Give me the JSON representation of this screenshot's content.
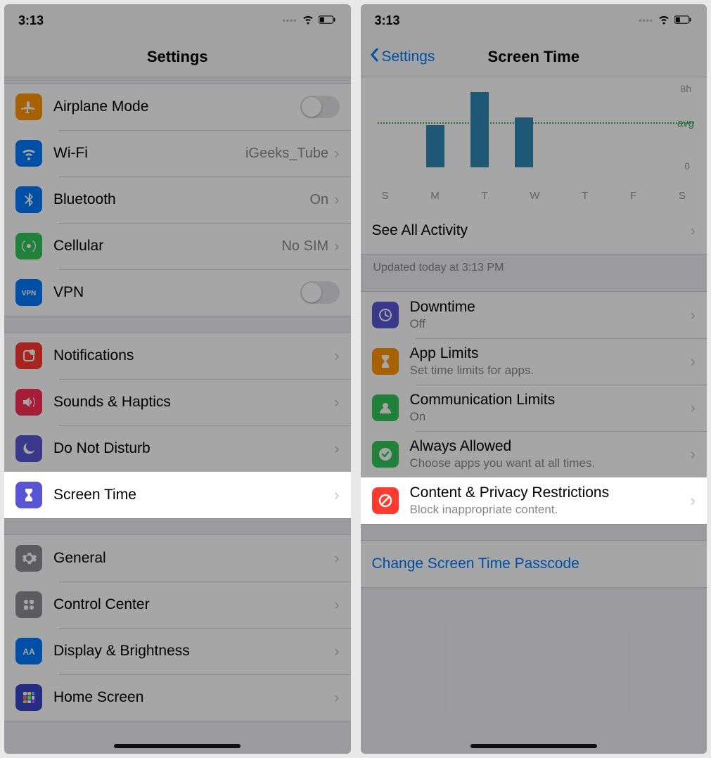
{
  "statusbar": {
    "time": "3:13"
  },
  "left": {
    "title": "Settings",
    "groups": [
      [
        {
          "name": "airplane-mode",
          "icon": "airplane",
          "ibg": "#ff9500",
          "label": "Airplane Mode",
          "type": "toggle"
        },
        {
          "name": "wifi",
          "icon": "wifi",
          "ibg": "#007aff",
          "label": "Wi-Fi",
          "value": "iGeeks_Tube"
        },
        {
          "name": "bluetooth",
          "icon": "bluetooth",
          "ibg": "#007aff",
          "label": "Bluetooth",
          "value": "On"
        },
        {
          "name": "cellular",
          "icon": "cellular",
          "ibg": "#34c759",
          "label": "Cellular",
          "value": "No SIM"
        },
        {
          "name": "vpn",
          "icon": "vpn",
          "ibg": "#007aff",
          "label": "VPN",
          "type": "toggle"
        }
      ],
      [
        {
          "name": "notifications",
          "icon": "notifications",
          "ibg": "#ff3b30",
          "label": "Notifications"
        },
        {
          "name": "sounds-haptics",
          "icon": "sounds",
          "ibg": "#ff2d55",
          "label": "Sounds & Haptics"
        },
        {
          "name": "do-not-disturb",
          "icon": "moon",
          "ibg": "#5856d6",
          "label": "Do Not Disturb"
        },
        {
          "name": "screen-time",
          "icon": "hourglass",
          "ibg": "#5856d6",
          "label": "Screen Time",
          "highlight": true
        }
      ],
      [
        {
          "name": "general",
          "icon": "gear",
          "ibg": "#8e8e93",
          "label": "General"
        },
        {
          "name": "control-center",
          "icon": "controlcenter",
          "ibg": "#8e8e93",
          "label": "Control Center"
        },
        {
          "name": "display-brightness",
          "icon": "display",
          "ibg": "#007aff",
          "label": "Display & Brightness"
        },
        {
          "name": "home-screen",
          "icon": "grid",
          "ibg": "#3a46c9",
          "label": "Home Screen"
        }
      ]
    ]
  },
  "right": {
    "back": "Settings",
    "title": "Screen Time",
    "chart_data": {
      "type": "bar",
      "categories": [
        "S",
        "M",
        "T",
        "W",
        "T",
        "F",
        "S"
      ],
      "values": [
        0,
        4.2,
        7.5,
        5.0,
        0,
        0,
        0
      ],
      "avg": 4.5,
      "ylim": [
        0,
        8
      ],
      "ylabel_top": "8h",
      "ylabel_bottom": "0",
      "avg_label": "avg"
    },
    "see_all": "See All Activity",
    "updated": "Updated today at 3:13 PM",
    "items": [
      {
        "name": "downtime",
        "icon": "clock",
        "ibg": "#5856d6",
        "label": "Downtime",
        "sub": "Off"
      },
      {
        "name": "app-limits",
        "icon": "hourglass",
        "ibg": "#ff9500",
        "label": "App Limits",
        "sub": "Set time limits for apps."
      },
      {
        "name": "communication-limits",
        "icon": "person",
        "ibg": "#34c759",
        "label": "Communication Limits",
        "sub": "On"
      },
      {
        "name": "always-allowed",
        "icon": "check",
        "ibg": "#34c759",
        "label": "Always Allowed",
        "sub": "Choose apps you want at all times."
      },
      {
        "name": "content-privacy",
        "icon": "nosign",
        "ibg": "#ff3b30",
        "label": "Content & Privacy Restrictions",
        "sub": "Block inappropriate content.",
        "highlight": true
      }
    ],
    "passcode": "Change Screen Time Passcode"
  }
}
